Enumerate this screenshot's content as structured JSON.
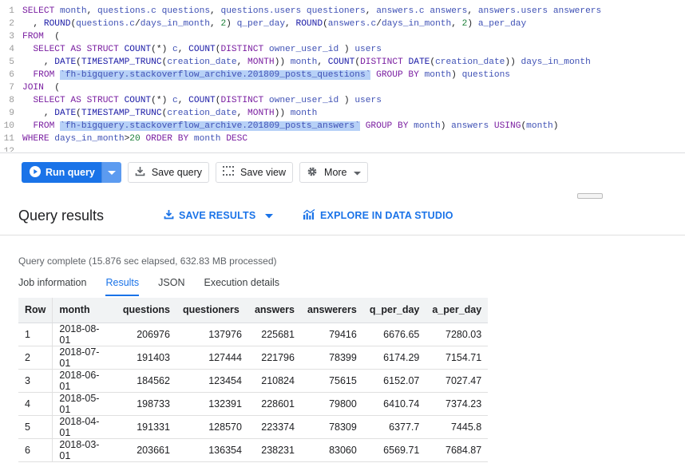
{
  "editor": {
    "lines": [
      {
        "n": "1"
      },
      {
        "n": "2"
      },
      {
        "n": "3"
      },
      {
        "n": "4"
      },
      {
        "n": "5"
      },
      {
        "n": "6"
      },
      {
        "n": "7"
      },
      {
        "n": "8"
      },
      {
        "n": "9"
      },
      {
        "n": "10"
      },
      {
        "n": "11"
      },
      {
        "n": "12"
      }
    ]
  },
  "toolbar": {
    "run_label": "Run query",
    "save_query_label": "Save query",
    "save_view_label": "Save view",
    "more_label": "More"
  },
  "results": {
    "title": "Query results",
    "save_results_label": "SAVE RESULTS",
    "explore_label": "EXPLORE IN DATA STUDIO",
    "status": "Query complete (15.876 sec elapsed, 632.83 MB processed)",
    "tabs": [
      "Job information",
      "Results",
      "JSON",
      "Execution details"
    ],
    "columns": [
      "Row",
      "month",
      "questions",
      "questioners",
      "answers",
      "answerers",
      "q_per_day",
      "a_per_day"
    ],
    "rows": [
      [
        "1",
        "2018-08-01",
        "206976",
        "137976",
        "225681",
        "79416",
        "6676.65",
        "7280.03"
      ],
      [
        "2",
        "2018-07-01",
        "191403",
        "127444",
        "221796",
        "78399",
        "6174.29",
        "7154.71"
      ],
      [
        "3",
        "2018-06-01",
        "184562",
        "123454",
        "210824",
        "75615",
        "6152.07",
        "7027.47"
      ],
      [
        "4",
        "2018-05-01",
        "198733",
        "132391",
        "228601",
        "79800",
        "6410.74",
        "7374.23"
      ],
      [
        "5",
        "2018-04-01",
        "191331",
        "128570",
        "223374",
        "78309",
        "6377.7",
        "7445.8"
      ],
      [
        "6",
        "2018-03-01",
        "203661",
        "136354",
        "238231",
        "83060",
        "6569.71",
        "7684.87"
      ]
    ]
  },
  "colors": {
    "accent": "#1a73e8",
    "keyword": "#7a1ea1",
    "highlight": "#b7d1f7"
  }
}
